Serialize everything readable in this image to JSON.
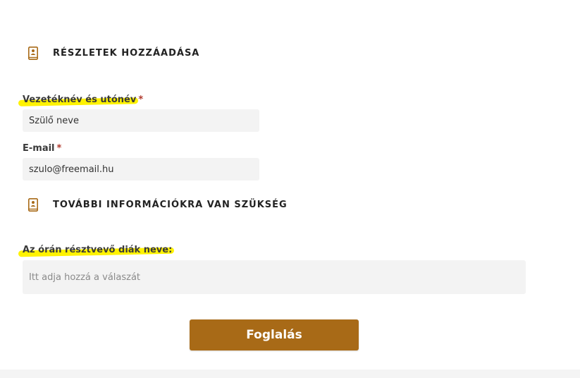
{
  "colors": {
    "accent": "#a86a17",
    "highlight": "#fff200",
    "input_bg": "#f3f3f3",
    "required": "#b03a2e"
  },
  "sections": [
    {
      "icon": "contact-book-icon",
      "title": "RÉSZLETEK HOZZÁADÁSA"
    },
    {
      "icon": "contact-book-icon",
      "title": "TOVÁBBI INFORMÁCIÓKRA VAN SZÜKSÉG"
    }
  ],
  "fields": {
    "name": {
      "label": "Vezetéknév és utónév",
      "required_mark": "*",
      "value": "Szülő neve"
    },
    "email": {
      "label": "E-mail",
      "required_mark": "*",
      "value": "szulo@freemail.hu"
    },
    "student": {
      "label": "Az órán résztvevő diák neve:",
      "placeholder": "Itt adja hozzá a válaszát"
    }
  },
  "submit": {
    "label": "Foglalás"
  }
}
